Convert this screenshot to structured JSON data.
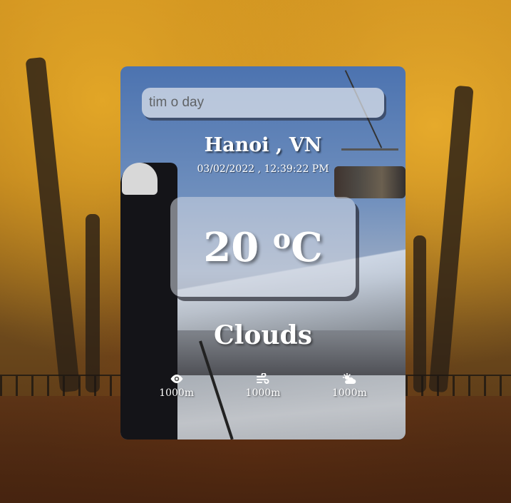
{
  "search": {
    "placeholder": "tim o day"
  },
  "location": {
    "city_line": "Hanoi , VN",
    "datetime": "03/02/2022 , 12:39:22 PM"
  },
  "weather": {
    "temperature_value": "20",
    "temperature_unit_symbol": "o",
    "temperature_unit_letter": "C",
    "condition": "Clouds"
  },
  "stats": [
    {
      "icon": "eye-icon",
      "value": "1000m"
    },
    {
      "icon": "wind-icon",
      "value": "1000m"
    },
    {
      "icon": "sun-cloud-icon",
      "value": "1000m"
    }
  ]
}
